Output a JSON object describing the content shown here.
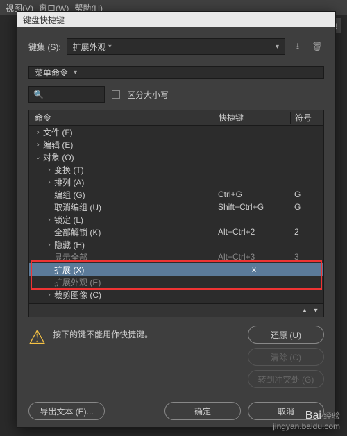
{
  "menubar": {
    "view": "视图(V)",
    "window": "窗口(W)",
    "help": "帮助(H)"
  },
  "hint_right": "首选项",
  "dialog": {
    "title": "键盘快捷键",
    "keyset_label": "键集 (S):",
    "keyset_value": "扩展外观 *",
    "section": "菜单命令",
    "search_placeholder": "",
    "case_label": "区分大小写",
    "columns": {
      "cmd": "命令",
      "key": "快捷键",
      "sym": "符号"
    },
    "rows": [
      {
        "indent": 0,
        "toggle": ">",
        "label": "文件 (F)",
        "key": "",
        "sym": ""
      },
      {
        "indent": 0,
        "toggle": ">",
        "label": "编辑 (E)",
        "key": "",
        "sym": ""
      },
      {
        "indent": 0,
        "toggle": "v",
        "label": "对象 (O)",
        "key": "",
        "sym": ""
      },
      {
        "indent": 1,
        "toggle": ">",
        "label": "变换 (T)",
        "key": "",
        "sym": ""
      },
      {
        "indent": 1,
        "toggle": ">",
        "label": "排列 (A)",
        "key": "",
        "sym": ""
      },
      {
        "indent": 1,
        "toggle": "",
        "label": "编组 (G)",
        "key": "Ctrl+G",
        "sym": "G"
      },
      {
        "indent": 1,
        "toggle": "",
        "label": "取消编组 (U)",
        "key": "Shift+Ctrl+G",
        "sym": "G"
      },
      {
        "indent": 1,
        "toggle": ">",
        "label": "锁定 (L)",
        "key": "",
        "sym": ""
      },
      {
        "indent": 1,
        "toggle": "",
        "label": "全部解锁 (K)",
        "key": "Alt+Ctrl+2",
        "sym": "2"
      },
      {
        "indent": 1,
        "toggle": ">",
        "label": "隐藏 (H)",
        "key": "",
        "sym": ""
      },
      {
        "indent": 1,
        "toggle": "",
        "label": "显示全部",
        "key": "Alt+Ctrl+3",
        "sym": "3",
        "dim": true
      },
      {
        "indent": 1,
        "toggle": "",
        "label": "扩展 (X)",
        "key": "x",
        "sym": "",
        "selected": true
      },
      {
        "indent": 1,
        "toggle": "",
        "label": "扩展外观 (E)",
        "key": "",
        "sym": "",
        "dim": true
      },
      {
        "indent": 1,
        "toggle": ">",
        "label": "裁剪图像 (C)",
        "key": "",
        "sym": ""
      }
    ],
    "warning": "按下的键不能用作快捷键。",
    "btn_undo": "还原 (U)",
    "btn_clear": "清除 (C)",
    "btn_goto": "转到冲突处 (G)",
    "btn_export": "导出文本 (E)...",
    "btn_ok": "确定",
    "btn_cancel": "取消"
  },
  "watermark": {
    "logo": "Bai",
    "sub": "经验",
    "url": "jingyan.baidu.com"
  }
}
